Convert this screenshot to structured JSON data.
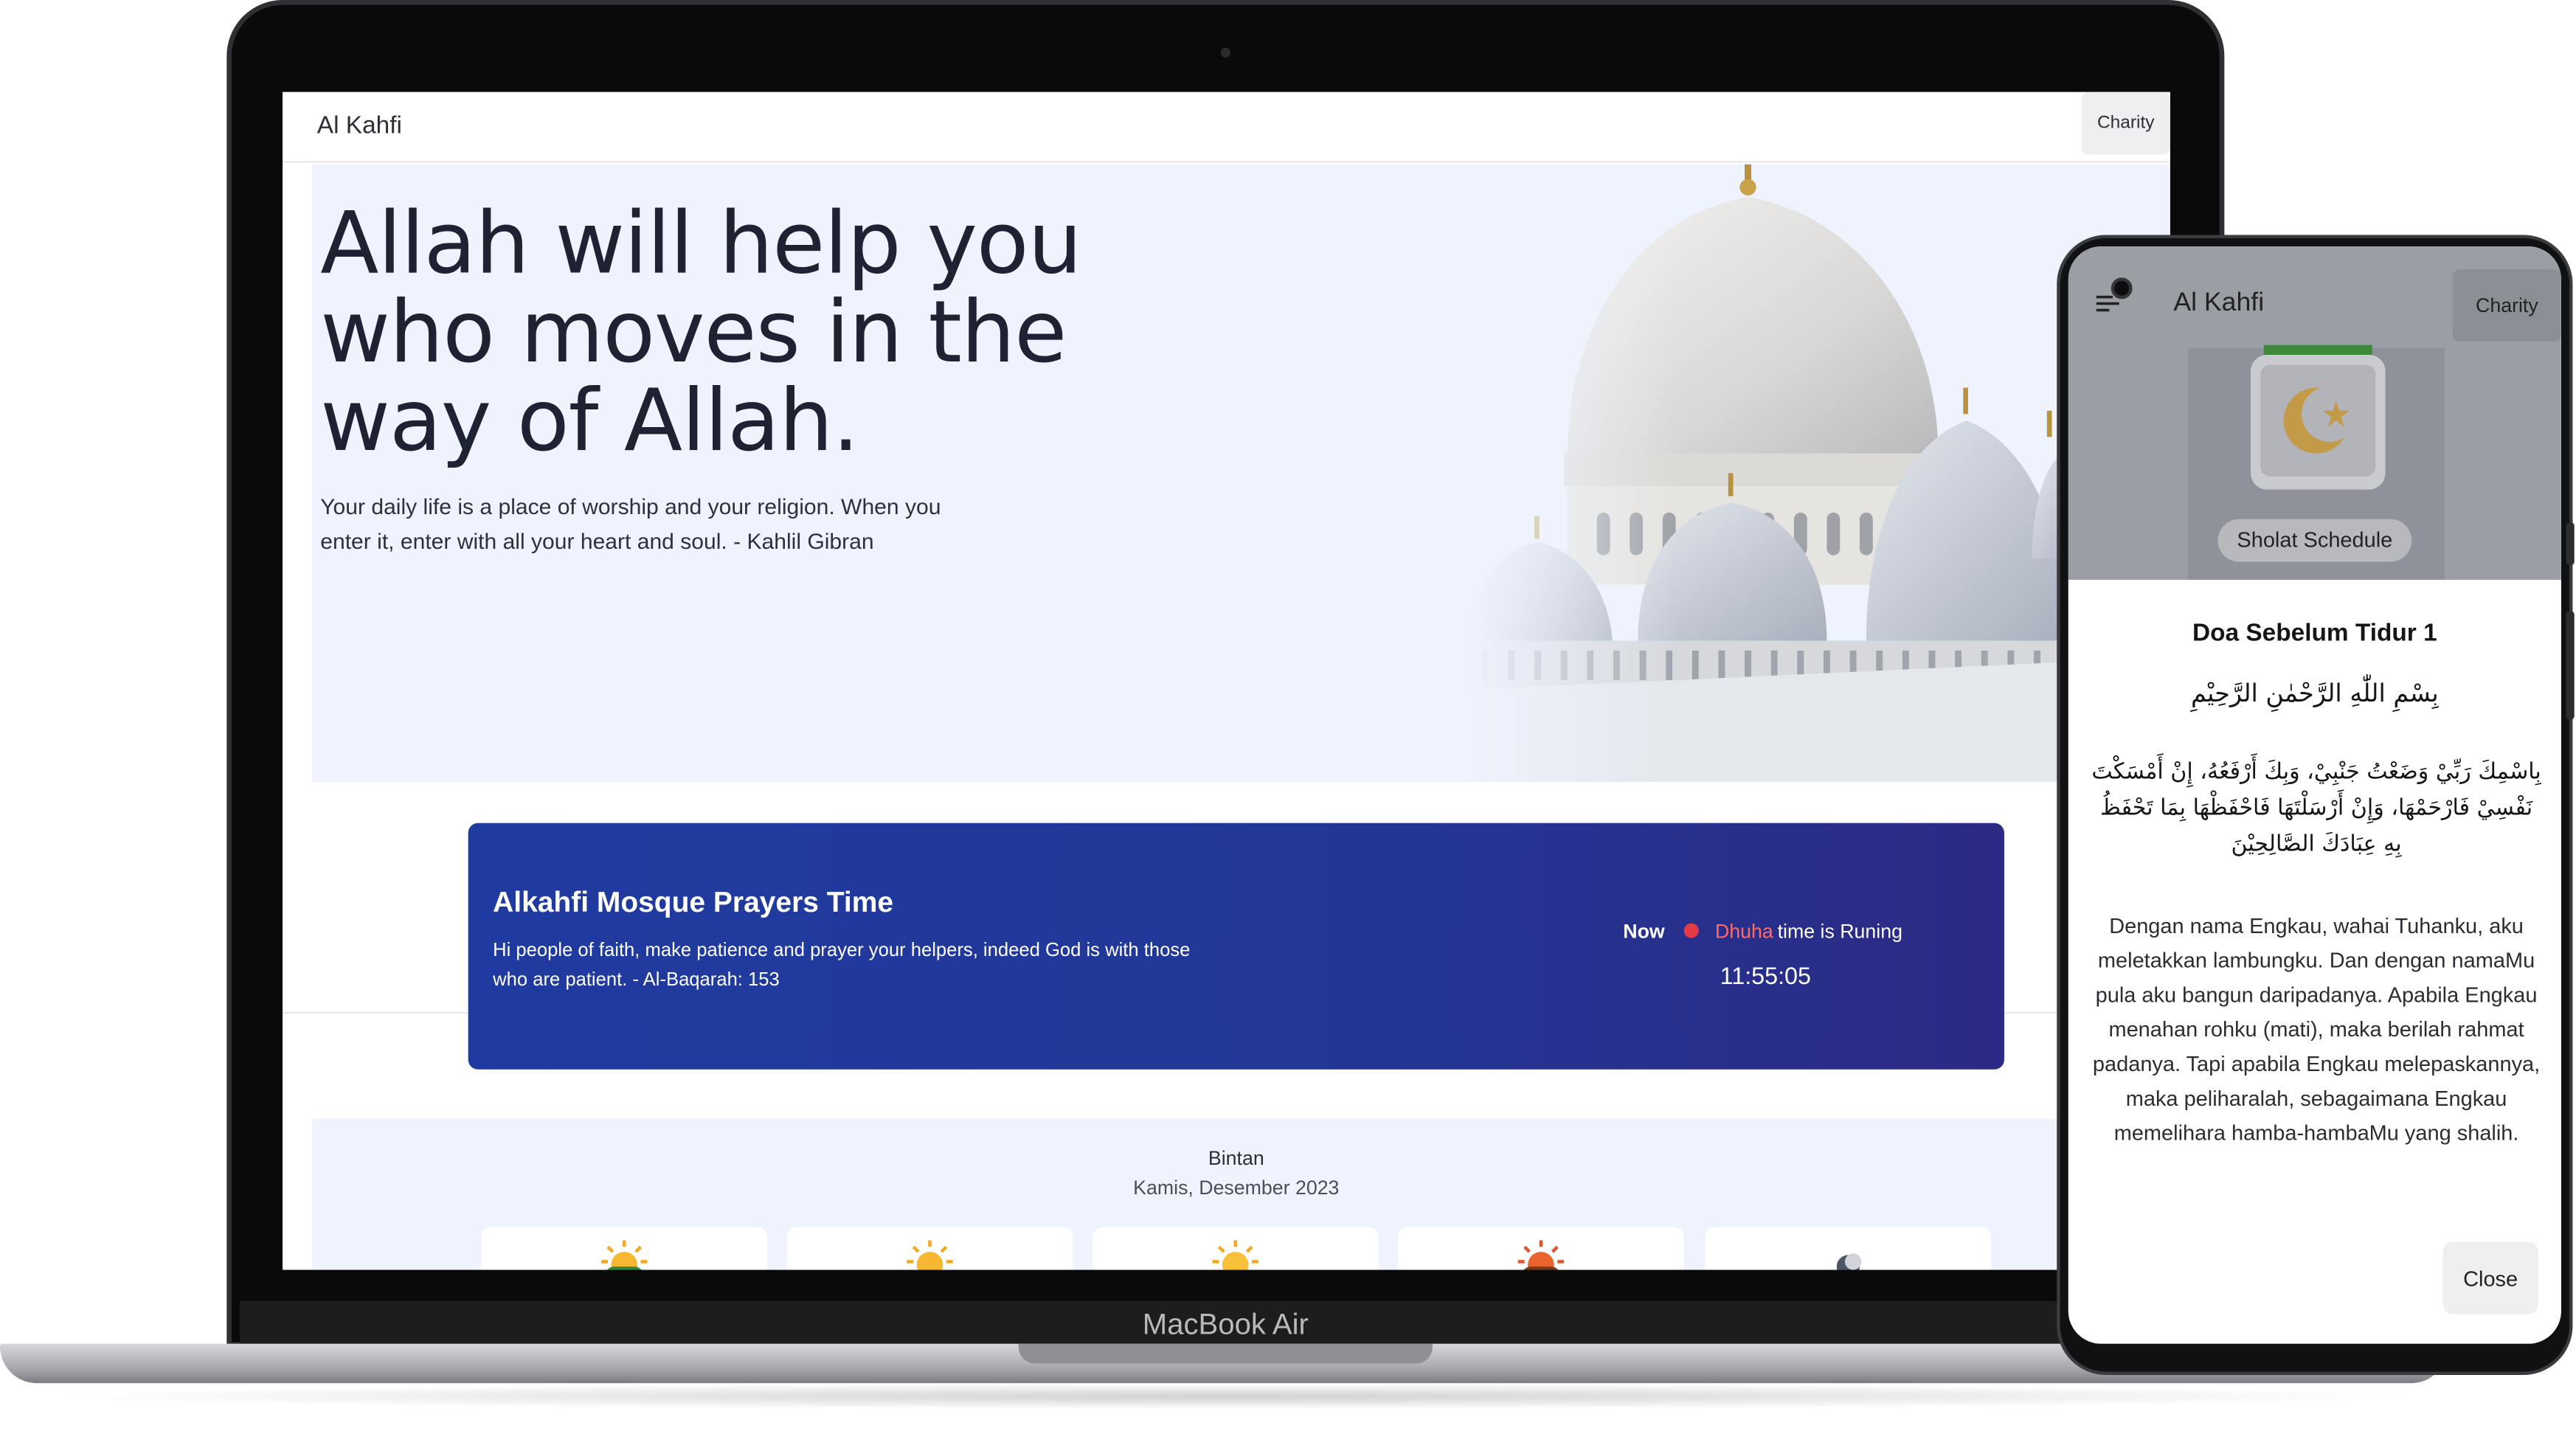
{
  "laptop": {
    "brand_label": "MacBook Air",
    "navbar": {
      "brand": "Al Kahfi",
      "charity_label": "Charity"
    },
    "hero": {
      "title": "Allah will help you who moves in the way of Allah.",
      "quote": "Your daily life is a place of worship and your religion. When you enter it, enter with all your heart and soul. - Kahlil Gibran"
    },
    "prayer_banner": {
      "title": "Alkahfi Mosque Prayers Time",
      "description": "Hi people of faith, make patience and prayer your helpers, indeed God is with those who are patient. - Al-Baqarah: 153",
      "now_label": "Now",
      "current_prayer": "Dhuha",
      "status_text": "time is Runing",
      "clock": "11:55:05"
    },
    "schedule": {
      "city": "Bintan",
      "date": "Kamis, Desember 2023",
      "card_icons": [
        "sunrise-icon",
        "sun-icon",
        "sun-icon",
        "sunset-icon",
        "moon-icon"
      ]
    }
  },
  "phone": {
    "header": {
      "brand": "Al Kahfi",
      "charity_label": "Charity"
    },
    "menu_tile": {
      "label": "Sholat Schedule",
      "icon": "calendar-crescent-icon"
    },
    "modal": {
      "title": "Doa Sebelum Tidur 1",
      "basmala": "بِسْمِ اللّٰهِ الرَّحْمٰنِ الرَّحِيْمِ",
      "arabic": "بِاسْمِكَ رَبِّيْ وَضَعْتُ جَنْبِيْ، وَبِكَ أَرْفَعُهُ، إِنْ أَمْسَكْتَ نَفْسِيْ فَارْحَمْهَا، وَإِنْ أَرْسَلْتَهَا فَاحْفَظْهَا بِمَا تَحْفَظُ بِهِ عِبَادَكَ الصَّالِحِيْنَ",
      "translation": "Dengan nama Engkau, wahai Tuhanku, aku meletakkan lambungku. Dan dengan namaMu pula aku bangun daripadanya. Apabila Engkau menahan rohku (mati), maka berilah rahmat padanya. Tapi apabila Engkau melepaskannya, maka peliharalah, sebagaimana Engkau memelihara hamba-hambaMu yang shalih.",
      "close_label": "Close"
    }
  },
  "colors": {
    "banner_start": "#1f3ba1",
    "banner_end": "#2b2a84",
    "live_dot": "#e23b48",
    "current_prayer": "#ff6a6a",
    "hero_bg": "#eef3fd"
  }
}
